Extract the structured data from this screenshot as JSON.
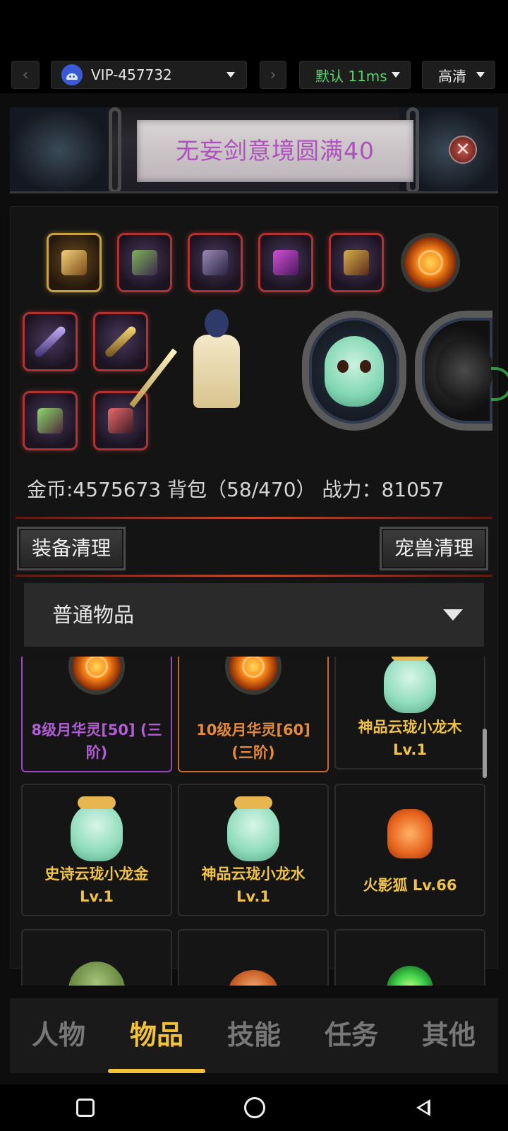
{
  "toolbar": {
    "back_glyph": "‹",
    "forward_glyph": "›",
    "account_label": "VIP-457732",
    "latency_label": "默认 11ms",
    "quality_label": "高清",
    "accent_green": "#58d26a"
  },
  "banner": {
    "title": "无妄剑意境圆满40",
    "close_glyph": "✕"
  },
  "equipment": {
    "slots": [
      "helmet",
      "armor",
      "shoulder",
      "bracer",
      "book",
      "moon-orb",
      "sword",
      "blade",
      "belt",
      "ring"
    ],
    "pets": [
      "azure-dragon",
      "black-tiger"
    ]
  },
  "stats": {
    "text": "金币:4575673 背包（58/470） 战力：81057"
  },
  "actions": {
    "equip_clean": "装备清理",
    "pet_clean": "宠兽清理"
  },
  "filter": {
    "selected": "普通物品"
  },
  "items": [
    {
      "name": "8级月华灵[50] (三阶)",
      "rarity": "purple",
      "icon": "moon-orb-icon"
    },
    {
      "name": "10级月华灵[60] (三阶)",
      "rarity": "orange",
      "icon": "moon-orb-icon"
    },
    {
      "name": "神品云珑小龙木 Lv.1",
      "rarity": "gold",
      "icon": "dragon-pet-icon"
    },
    {
      "name": "史诗云珑小龙金 Lv.1",
      "rarity": "gold",
      "icon": "dragon-pet-icon"
    },
    {
      "name": "神品云珑小龙水 Lv.1",
      "rarity": "gold",
      "icon": "dragon-pet-icon"
    },
    {
      "name": "火影狐 Lv.66",
      "rarity": "gold",
      "icon": "fox-pet-icon"
    },
    {
      "name": "",
      "rarity": "gold",
      "icon": "turtle-pet-icon"
    },
    {
      "name": "",
      "rarity": "gold",
      "icon": "shell-pet-icon"
    },
    {
      "name": "",
      "rarity": "gold",
      "icon": "green-orb-icon"
    }
  ],
  "tabs": [
    {
      "label": "人物",
      "active": false
    },
    {
      "label": "物品",
      "active": true
    },
    {
      "label": "技能",
      "active": false
    },
    {
      "label": "任务",
      "active": false
    },
    {
      "label": "其他",
      "active": false
    }
  ],
  "colors": {
    "tab_active": "#f1c23a",
    "rarity_purple": "#9b44c6",
    "rarity_orange": "#c8682a",
    "rarity_gold": "#f0c24a"
  }
}
